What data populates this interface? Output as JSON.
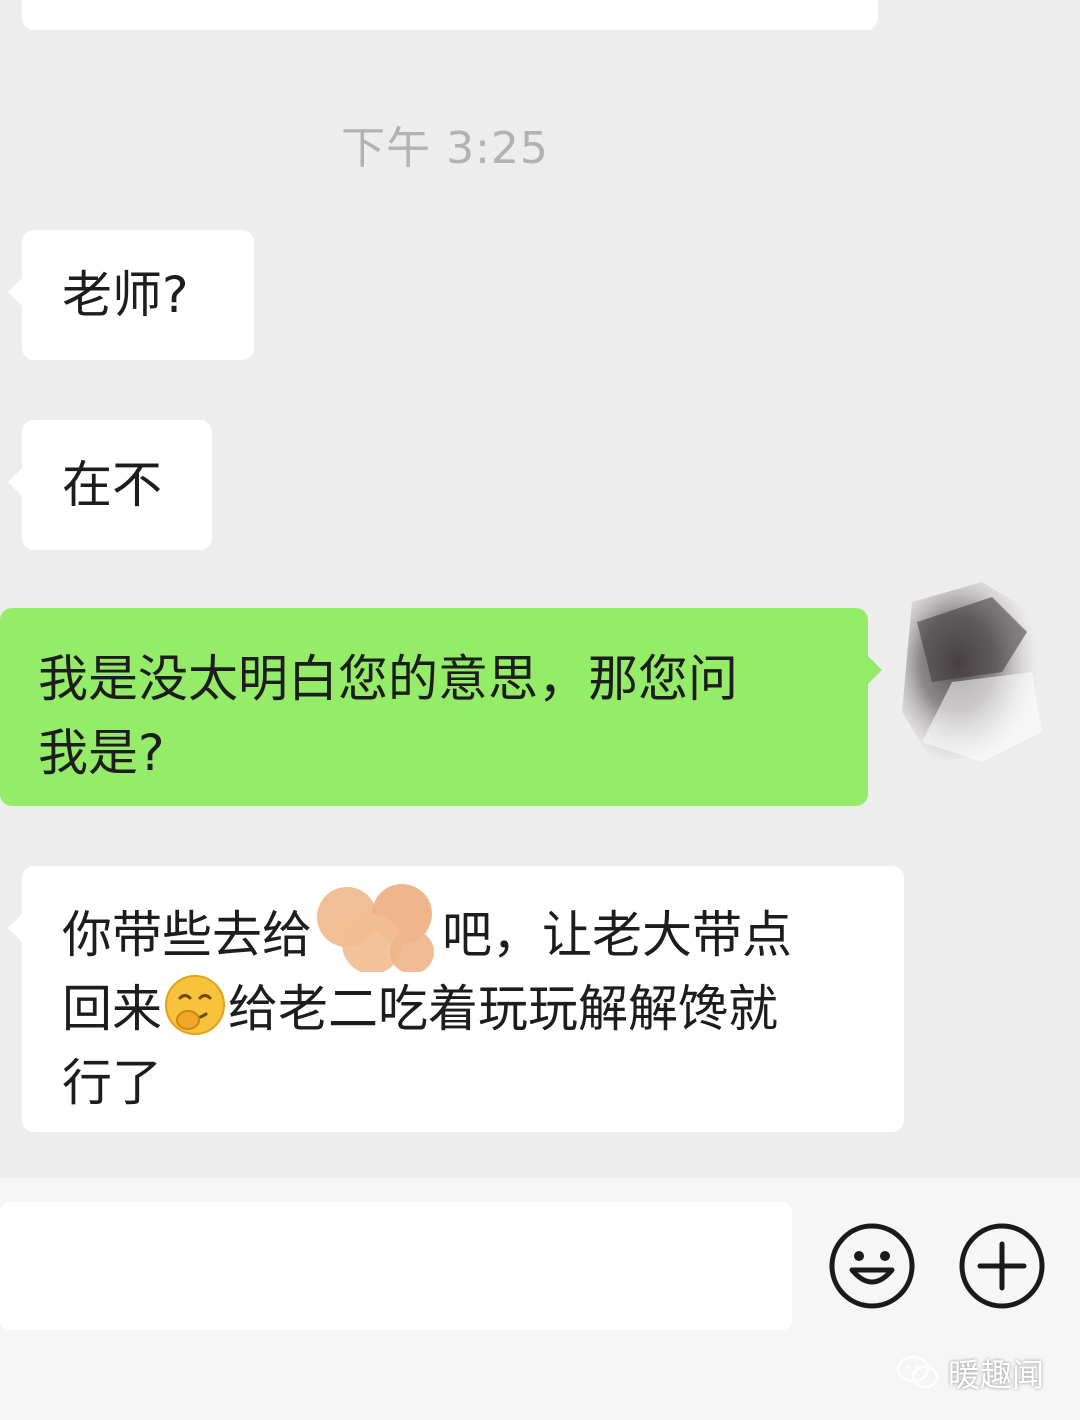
{
  "chat": {
    "timestamp": "下午 3:25",
    "messages": [
      {
        "side": "incoming",
        "text": "老师?"
      },
      {
        "side": "incoming",
        "text": "在不"
      },
      {
        "side": "outgoing",
        "lines": [
          "我是没太明白您的意思，那您问",
          "我是?"
        ]
      },
      {
        "side": "incoming",
        "line1_before": "你带些去给",
        "line1_after": "吧，让老大带点",
        "line2_before": "回来",
        "line2_after": "给老二吃着玩玩解解馋就",
        "line3": "行了"
      }
    ]
  },
  "input": {
    "value": "",
    "emoji_icon": "smiley-face-icon",
    "plus_icon": "plus-circle-icon"
  },
  "watermark": {
    "text": "暖趣闻"
  },
  "colors": {
    "background": "#ededed",
    "incoming_bubble": "#ffffff",
    "outgoing_bubble": "#95ec69",
    "timestamp": "#b2b2b2"
  }
}
